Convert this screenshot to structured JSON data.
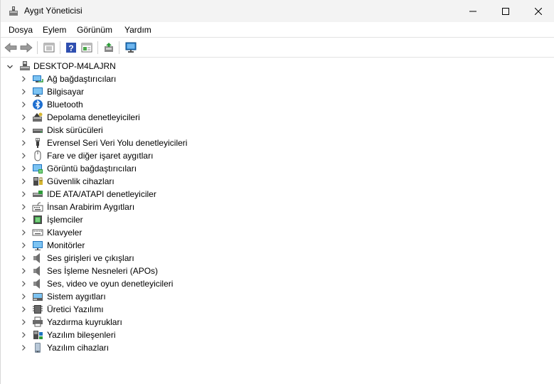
{
  "window": {
    "title": "Aygıt Yöneticisi"
  },
  "menu": [
    "Dosya",
    "Eylem",
    "Görünüm",
    "Yardım"
  ],
  "tree": {
    "root": "DESKTOP-M4LAJRN",
    "items": [
      {
        "label": "Ağ bağdaştırıcıları",
        "icon": "network-adapter-icon"
      },
      {
        "label": "Bilgisayar",
        "icon": "computer-icon"
      },
      {
        "label": "Bluetooth",
        "icon": "bluetooth-icon"
      },
      {
        "label": "Depolama denetleyicileri",
        "icon": "storage-controller-icon"
      },
      {
        "label": "Disk sürücüleri",
        "icon": "disk-drive-icon"
      },
      {
        "label": "Evrensel Seri Veri Yolu denetleyicileri",
        "icon": "usb-icon"
      },
      {
        "label": "Fare ve diğer işaret aygıtları",
        "icon": "mouse-icon"
      },
      {
        "label": "Görüntü bağdaştırıcıları",
        "icon": "display-adapter-icon"
      },
      {
        "label": "Güvenlik cihazları",
        "icon": "security-device-icon"
      },
      {
        "label": "IDE ATA/ATAPI denetleyiciler",
        "icon": "ide-controller-icon"
      },
      {
        "label": "İnsan Arabirim Aygıtları",
        "icon": "hid-icon"
      },
      {
        "label": "İşlemciler",
        "icon": "processor-icon"
      },
      {
        "label": "Klavyeler",
        "icon": "keyboard-icon"
      },
      {
        "label": "Monitörler",
        "icon": "monitor-icon"
      },
      {
        "label": "Ses girişleri ve çıkışları",
        "icon": "speaker-icon"
      },
      {
        "label": "Ses İşleme Nesneleri (APOs)",
        "icon": "speaker-icon"
      },
      {
        "label": "Ses, video ve oyun denetleyicileri",
        "icon": "speaker-icon"
      },
      {
        "label": "Sistem aygıtları",
        "icon": "system-device-icon"
      },
      {
        "label": "Üretici Yazılımı",
        "icon": "firmware-icon"
      },
      {
        "label": "Yazdırma kuyrukları",
        "icon": "printer-icon"
      },
      {
        "label": "Yazılım bileşenleri",
        "icon": "software-component-icon"
      },
      {
        "label": "Yazılım cihazları",
        "icon": "software-device-icon"
      }
    ]
  },
  "toolbar": {
    "buttons": [
      "back-icon",
      "forward-icon",
      "properties-icon",
      "help-icon",
      "show-hide-icon",
      "update-driver-icon",
      "scan-hardware-icon"
    ]
  },
  "colors": {
    "titlebar": "#f3f3f3",
    "accent_blue": "#1e73be",
    "chevron": "#606060"
  }
}
